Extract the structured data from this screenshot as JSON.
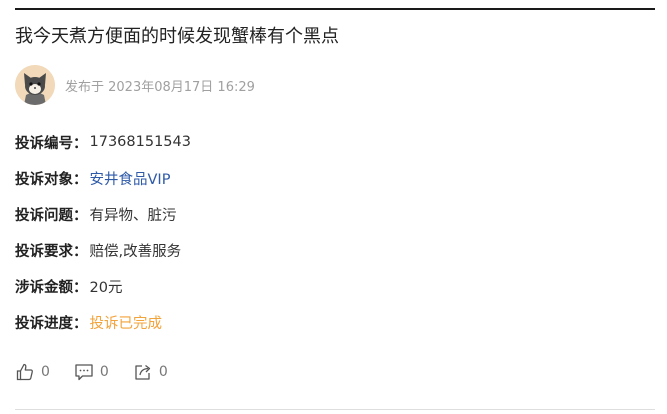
{
  "post": {
    "title": "我今天煮方便面的时候发现蟹棒有个黑点",
    "publish_text": "发布于 2023年08月17日 16:29"
  },
  "details": [
    {
      "label": "投诉编号：",
      "value": "17368151543",
      "style": "plain"
    },
    {
      "label": "投诉对象：",
      "value": "安井食品VIP",
      "style": "link"
    },
    {
      "label": "投诉问题：",
      "value": "有异物、脏污",
      "style": "plain"
    },
    {
      "label": "投诉要求：",
      "value": "赔偿,改善服务",
      "style": "plain"
    },
    {
      "label": "涉诉金额：",
      "value": "20元",
      "style": "plain"
    },
    {
      "label": "投诉进度：",
      "value": "投诉已完成",
      "style": "progress"
    }
  ],
  "actions": {
    "like_count": "0",
    "comment_count": "0",
    "share_count": "0"
  },
  "colors": {
    "link": "#2e5aa8",
    "progress": "#f3a33b",
    "muted": "#a0a0a0"
  }
}
